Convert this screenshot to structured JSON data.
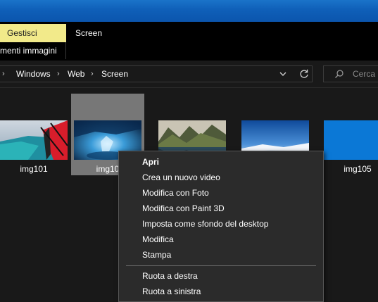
{
  "ribbon": {
    "tab_gestisci": "Gestisci",
    "tab_gestisci_sub": "menti immagini",
    "tab_screen": "Screen"
  },
  "address": {
    "crumbs": [
      "Windows",
      "Web",
      "Screen"
    ],
    "separator_icon": "chevron-right-icon",
    "dropdown_icon": "chevron-down-icon",
    "refresh_icon": "refresh-icon"
  },
  "search": {
    "placeholder": "Cerca i",
    "icon": "search-icon"
  },
  "files": [
    {
      "label": "img101",
      "selected": false
    },
    {
      "label": "img10",
      "selected": true
    },
    {
      "label": "",
      "selected": false
    },
    {
      "label": "",
      "selected": false
    },
    {
      "label": "img105",
      "selected": false
    }
  ],
  "context_menu": {
    "items": [
      {
        "label": "Apri",
        "bold": true
      },
      {
        "label": "Crea un nuovo video",
        "bold": false
      },
      {
        "label": "Modifica con Foto",
        "bold": false
      },
      {
        "label": "Modifica con Paint 3D",
        "bold": false
      },
      {
        "label": "Imposta come sfondo del desktop",
        "bold": false
      },
      {
        "label": "Modifica",
        "bold": false
      },
      {
        "label": "Stampa",
        "bold": false
      },
      {
        "label": "Ruota a destra",
        "bold": false
      },
      {
        "label": "Ruota a sinistra",
        "bold": false
      }
    ]
  },
  "colors": {
    "ribbon_contextual_tab": "#f2ea8a",
    "desktop_blue": "#0f5fb8",
    "window_background": "#191919",
    "selection": "#777777",
    "menu_background": "#2b2b2b"
  }
}
